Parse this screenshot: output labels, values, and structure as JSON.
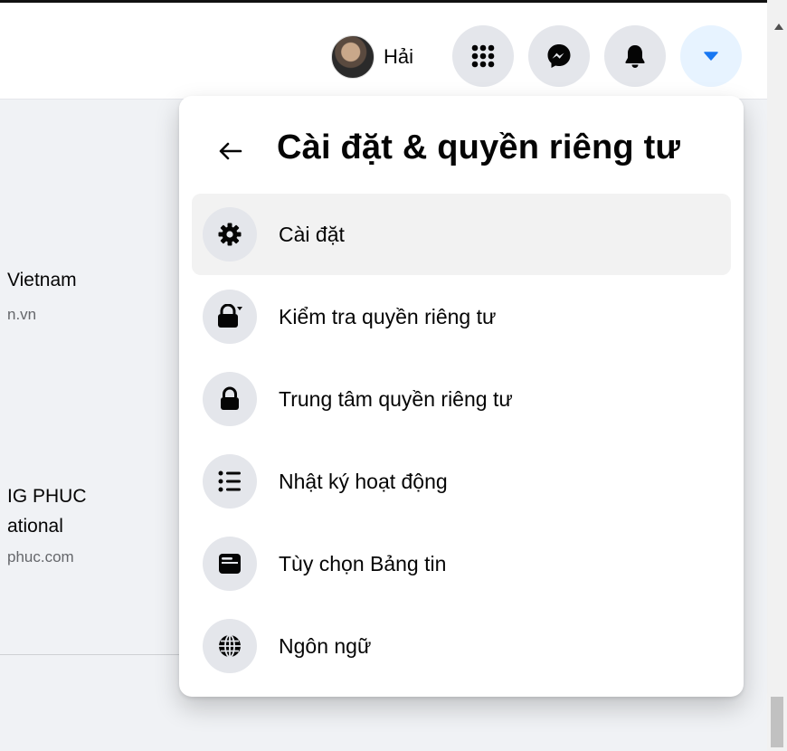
{
  "header": {
    "profile_name": "Hải",
    "icons": [
      "menu-grid-icon",
      "messenger-icon",
      "notification-bell-icon",
      "account-caret-icon"
    ],
    "accent": "#1877f2"
  },
  "feed": {
    "item1_title": "Vietnam",
    "item1_sub": "n.vn",
    "item2_title1": "IG PHUC",
    "item2_title2": "ational",
    "item2_sub": "phuc.com"
  },
  "menu": {
    "title": "Cài đặt & quyền riêng tư",
    "items": [
      {
        "label": "Cài đặt",
        "icon": "gear-icon"
      },
      {
        "label": "Kiểm tra quyền riêng tư",
        "icon": "lock-check-icon"
      },
      {
        "label": "Trung tâm quyền riêng tư",
        "icon": "lock-icon"
      },
      {
        "label": "Nhật ký hoạt động",
        "icon": "list-icon"
      },
      {
        "label": "Tùy chọn Bảng tin",
        "icon": "feed-window-icon"
      },
      {
        "label": "Ngôn ngữ",
        "icon": "globe-icon"
      }
    ]
  }
}
